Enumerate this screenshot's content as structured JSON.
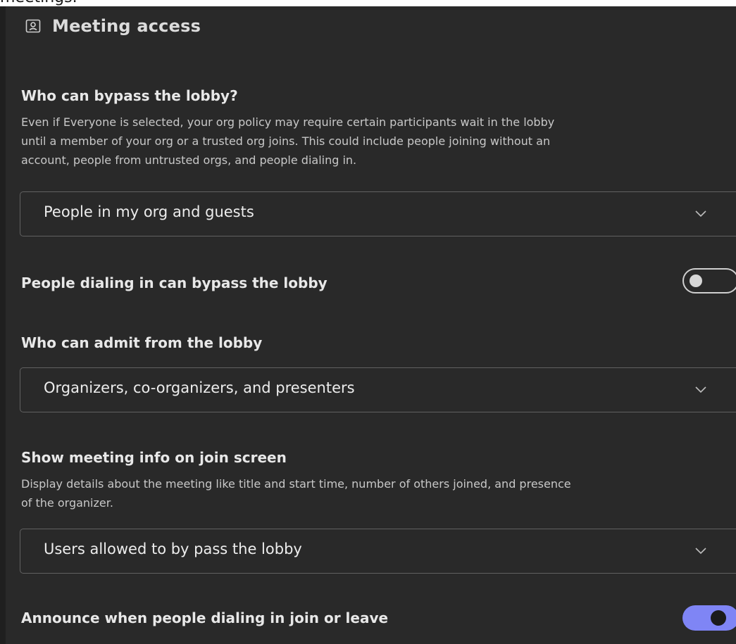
{
  "clipped_top_text": "meetings.",
  "section": {
    "title": "Meeting access",
    "icon": "person-card-icon"
  },
  "bypass_lobby": {
    "label": "Who can bypass the lobby?",
    "description_lines": [
      "Even if Everyone is selected, your org policy may require certain participants wait in the lobby",
      "until a member of your org or a trusted org joins. This could include people joining without an",
      "account, people from untrusted orgs, and people dialing in."
    ],
    "selected": "People in my org and guests"
  },
  "dial_in_bypass": {
    "label": "People dialing in can bypass the lobby",
    "enabled": false
  },
  "admit_from_lobby": {
    "label": "Who can admit from the lobby",
    "selected": "Organizers, co-organizers, and presenters"
  },
  "meeting_info": {
    "label": "Show meeting info on join screen",
    "description_lines": [
      "Display details about the meeting like title and start time, number of others joined, and presence",
      "of the organizer."
    ],
    "selected": "Users allowed to by pass the lobby"
  },
  "announce_dial_in": {
    "label": "Announce when people dialing in join or leave",
    "enabled": true
  },
  "colors": {
    "panel_bg": "#292929",
    "toggle_on": "#7f85f5",
    "border": "#616161"
  }
}
